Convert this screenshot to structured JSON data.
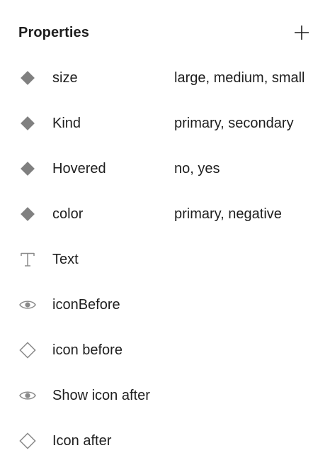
{
  "panel": {
    "title": "Properties",
    "add_icon": "plus-icon"
  },
  "properties": [
    {
      "name": "size",
      "value": "large, medium, small",
      "icon": "variant-diamond-filled-icon"
    },
    {
      "name": "Kind",
      "value": "primary, secondary",
      "icon": "variant-diamond-filled-icon"
    },
    {
      "name": "Hovered",
      "value": "no, yes",
      "icon": "variant-diamond-filled-icon"
    },
    {
      "name": "color",
      "value": "primary, negative",
      "icon": "variant-diamond-filled-icon"
    },
    {
      "name": "Text",
      "value": "",
      "icon": "text-icon"
    },
    {
      "name": "iconBefore",
      "value": "",
      "icon": "eye-icon"
    },
    {
      "name": "icon before",
      "value": "",
      "icon": "instance-diamond-outline-icon"
    },
    {
      "name": "Show icon after",
      "value": "",
      "icon": "eye-icon"
    },
    {
      "name": "Icon after",
      "value": "",
      "icon": "instance-diamond-outline-icon"
    }
  ],
  "colors": {
    "text": "#1e1e1e",
    "icon": "#8a8a8a",
    "background": "#ffffff"
  }
}
